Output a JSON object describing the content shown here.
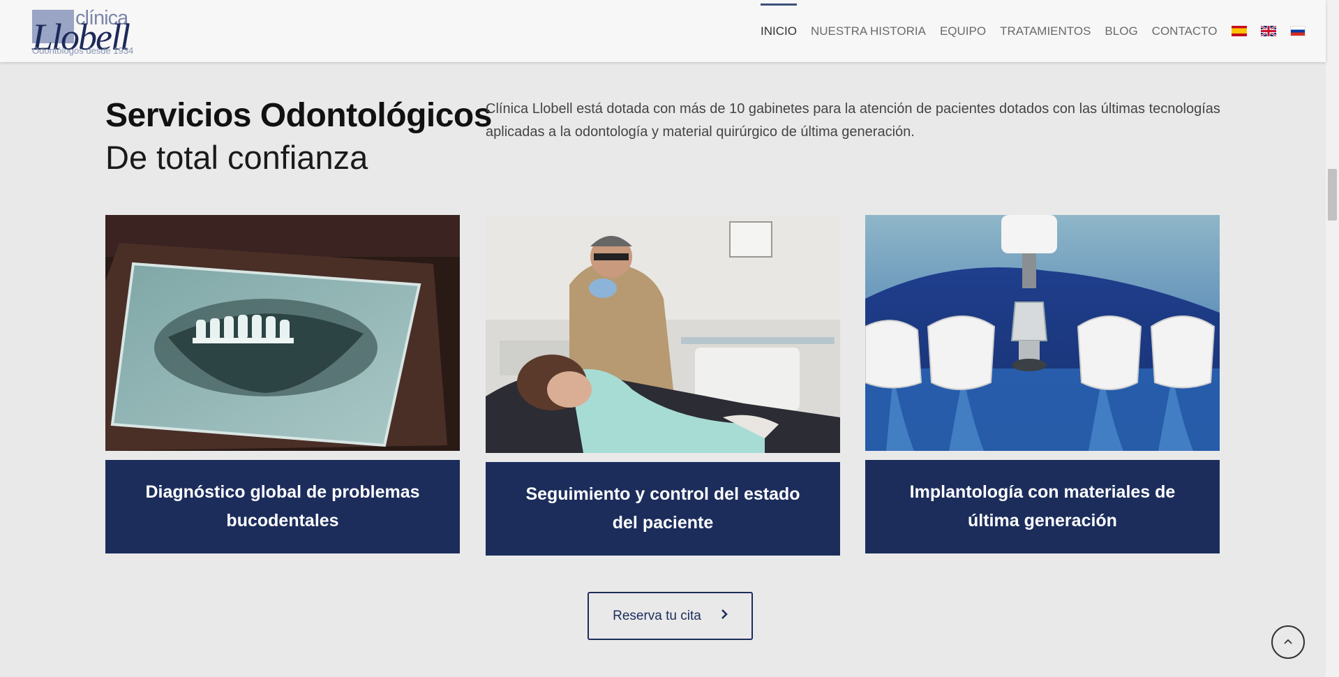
{
  "brand": {
    "clinica": "clínica",
    "name": "Llobell",
    "tagline": "Odontólogos desde 1934"
  },
  "nav": {
    "items": [
      {
        "label": "INICIO",
        "active": true
      },
      {
        "label": "NUESTRA HISTORIA",
        "active": false
      },
      {
        "label": "EQUIPO",
        "active": false
      },
      {
        "label": "TRATAMIENTOS",
        "active": false
      },
      {
        "label": "BLOG",
        "active": false
      },
      {
        "label": "CONTACTO",
        "active": false
      }
    ],
    "flags": [
      "spain-flag-icon",
      "uk-flag-icon",
      "russia-flag-icon"
    ]
  },
  "intro": {
    "title": "Servicios Odontológicos",
    "subtitle": "De total confianza",
    "text": "Clínica Llobell está dotada con más de 10 gabinetes para la atención de pacientes dotados con las últimas tecnologías aplicadas a la odontología y material quirúrgico de última generación."
  },
  "cards": [
    {
      "label": "Diagnóstico global de problemas bucodentales",
      "image": "dental-xray-image"
    },
    {
      "label": "Seguimiento y control del estado del paciente",
      "image": "dentist-with-patient-image"
    },
    {
      "label": "Implantología con materiales de última generación",
      "image": "dental-implant-image"
    }
  ],
  "cta": {
    "label": "Reserva tu cita",
    "icon": "chevron-right-icon"
  },
  "back_to_top": {
    "icon": "chevron-up-icon"
  },
  "colors": {
    "navy": "#1c2d5c",
    "background": "#e9e9e9",
    "header": "#f7f7f7",
    "active_nav_bar": "#3c4f7a"
  }
}
